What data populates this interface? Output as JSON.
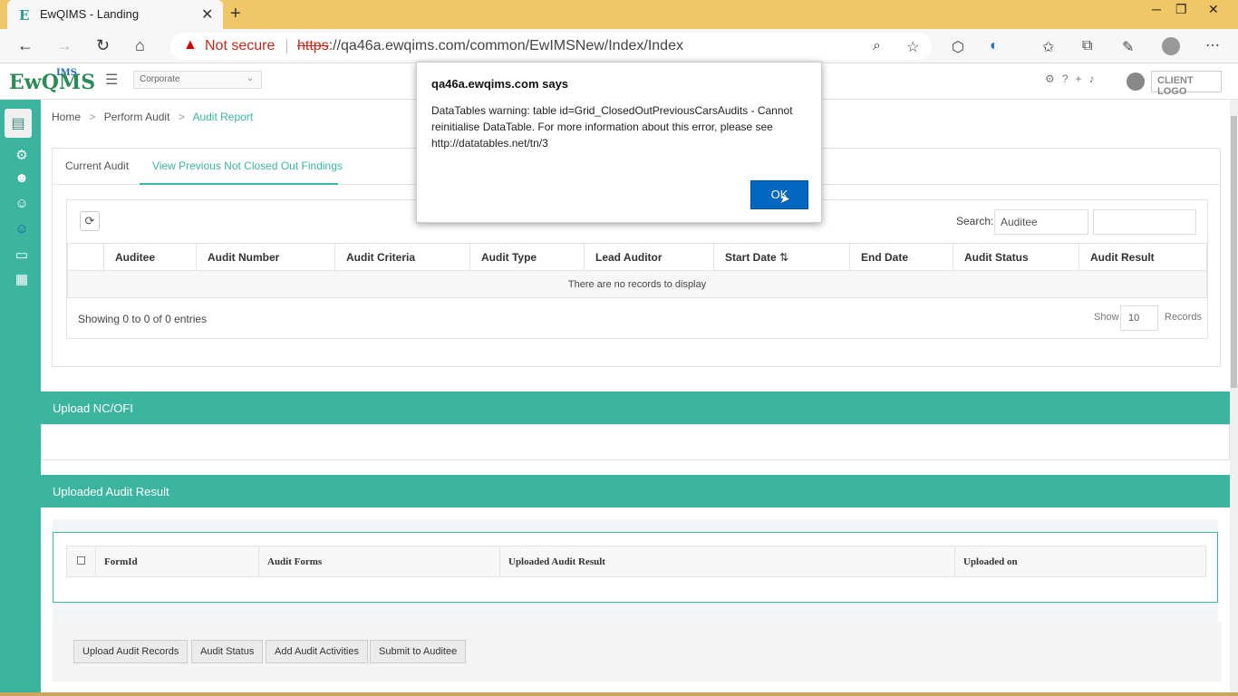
{
  "browser": {
    "tab_title": "EwQIMS - Landing",
    "tab_favicon": "E",
    "new_tab": "+",
    "not_secure": "Not secure",
    "url_scheme": "https",
    "url_rest": "://qa46a.ewqims.com/common/EwIMSNew/Index/Index",
    "warning_glyph": "▲"
  },
  "app": {
    "logo_text": "EwQMS",
    "logo_sup": "IMS",
    "corporate_select": "Corporate",
    "client_logo": "CLIENT LOGO",
    "sidebar_items": [
      "settings-icon",
      "users-icon",
      "user-add-icon",
      "user-check-icon",
      "id-card-icon",
      "building-icon"
    ]
  },
  "breadcrumb": {
    "home": "Home",
    "perform_audit": "Perform Audit",
    "current": "Audit Report",
    "sep": ">"
  },
  "tabs": {
    "current_audit": "Current Audit",
    "previous": "View Previous Not Closed Out Findings"
  },
  "grid": {
    "search_label": "Search:",
    "search_column": "Auditee",
    "search_value": "",
    "columns": [
      "",
      "Auditee",
      "Audit Number",
      "Audit Criteria",
      "Audit Type",
      "Lead Auditor",
      "Start Date",
      "End Date",
      "Audit Status",
      "Audit Result"
    ],
    "empty_message": "There are no records to display",
    "showing": "Showing 0 to 0 of 0 entries",
    "show_label": "Show",
    "page_size": "10",
    "records_label": "Records"
  },
  "sections": {
    "upload_nc": "Upload NC/OFI",
    "uploaded_result": "Uploaded Audit Result"
  },
  "upload_table": {
    "columns": [
      "FormId",
      "Audit Forms",
      "Uploaded Audit Result",
      "Uploaded on"
    ]
  },
  "actions": {
    "upload_records": "Upload Audit Records",
    "audit_status": "Audit Status",
    "add_activities": "Add Audit Activities",
    "submit": "Submit to Auditee"
  },
  "dialog": {
    "title": "qa46a.ewqims.com says",
    "message": "DataTables warning: table id=Grid_ClosedOutPreviousCarsAudits - Cannot reinitialise DataTable. For more information about this error, please see http://datatables.net/tn/3",
    "ok": "OK"
  },
  "colors": {
    "accent": "#3bb5a0",
    "browser_frame": "#f0c766",
    "ok_button": "#0067c0"
  }
}
